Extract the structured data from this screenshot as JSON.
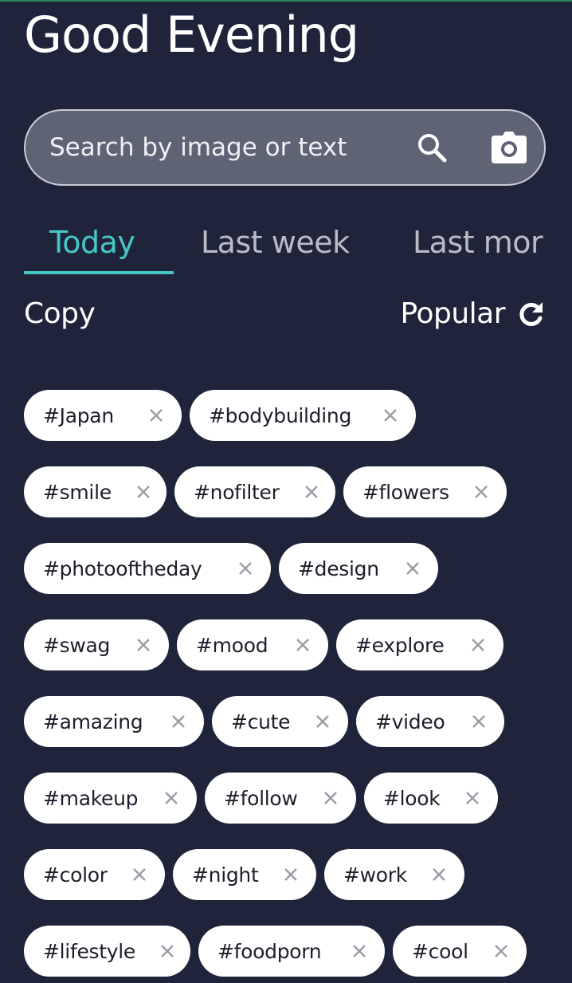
{
  "header": {
    "greeting": "Good Evening"
  },
  "search": {
    "placeholder": "Search by image or text",
    "search_icon": "search-icon",
    "camera_icon": "camera-icon"
  },
  "tabs": [
    {
      "label": "Today",
      "active": true
    },
    {
      "label": "Last week",
      "active": false
    },
    {
      "label": "Last mor",
      "active": false
    }
  ],
  "actions": {
    "copy_label": "Copy",
    "popular_label": "Popular",
    "refresh_icon": "refresh-icon"
  },
  "colors": {
    "background": "#1f243b",
    "accent": "#45c7c6",
    "search_bg": "#5f6475",
    "tag_bg": "#ffffff",
    "tag_text": "#1c1f2a"
  },
  "tags": [
    "#Japan",
    "#bodybuilding",
    "#smile",
    "#nofilter",
    "#flowers",
    "#photooftheday",
    "#design",
    "#swag",
    "#mood",
    "#explore",
    "#amazing",
    "#cute",
    "#video",
    "#makeup",
    "#follow",
    "#look",
    "#color",
    "#night",
    "#work",
    "#lifestyle",
    "#foodporn",
    "#cool"
  ]
}
